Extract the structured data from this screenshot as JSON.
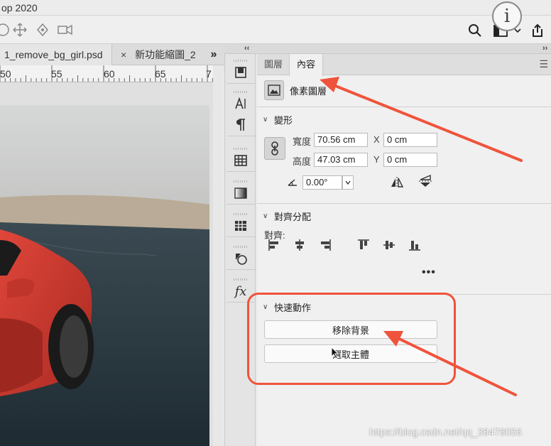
{
  "window": {
    "title": "op 2020"
  },
  "document_tabs": [
    {
      "label": "1_remove_bg_girl.psd",
      "active": true
    },
    {
      "label": "新功能縮圖_2",
      "active": false
    }
  ],
  "tabs_overflow_label": "»",
  "ruler": {
    "labels": [
      "50",
      "55",
      "60",
      "65",
      "7"
    ]
  },
  "panel": {
    "tabs": [
      {
        "label": "圖層",
        "active": false
      },
      {
        "label": "內容",
        "active": true
      }
    ],
    "layer_type_label": "像素圖層",
    "transform": {
      "header": "變形",
      "width_label": "寬度",
      "width_value": "70.56 cm",
      "height_label": "高度",
      "height_value": "47.03 cm",
      "x_label": "X",
      "x_value": "0 cm",
      "y_label": "Y",
      "y_value": "0 cm",
      "angle_value": "0.00°"
    },
    "align": {
      "header": "對齊分配",
      "subheader": "對齊:",
      "more_label": "•••"
    },
    "quick_actions": {
      "header": "快速動作",
      "remove_bg_label": "移除背景",
      "select_subject_label": "選取主體"
    }
  },
  "annotations": {
    "accent": "#f0533c"
  },
  "watermark": "https://blog.csdn.net/qq_38478056"
}
